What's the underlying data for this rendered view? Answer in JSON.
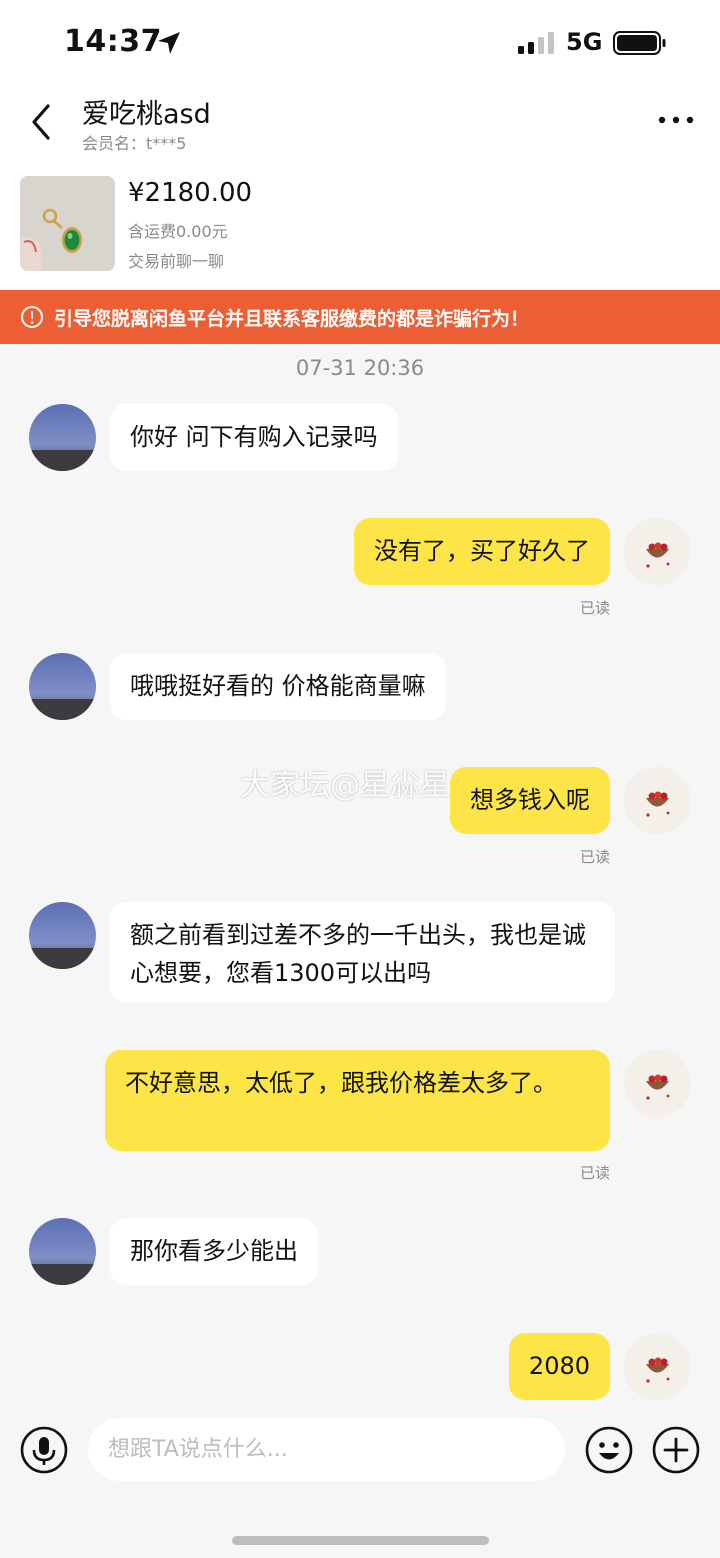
{
  "status_bar": {
    "time": "14:37",
    "network": "5G"
  },
  "header": {
    "title": "爱吃桃asd",
    "member_name": "会员名：t***5"
  },
  "product": {
    "price": "¥2180.00",
    "shipping": "含运费0.00元",
    "chat_hint": "交易前聊一聊"
  },
  "warning": {
    "text": "引导您脱离闲鱼平台并且联系客服缴费的都是诈骗行为！"
  },
  "timestamp": "07-31 20:36",
  "watermark": "大家坛@星尛星",
  "messages": [
    {
      "side": "in",
      "text": "你好 问下有购入记录吗"
    },
    {
      "side": "out",
      "text": "没有了，买了好久了",
      "status": "已读"
    },
    {
      "side": "in",
      "text": "哦哦挺好看的 价格能商量嘛"
    },
    {
      "side": "out",
      "text": "想多钱入呢",
      "status": "已读"
    },
    {
      "side": "in",
      "text": "额之前看到过差不多的一千出头，我也是诚心想要，您看1300可以出吗"
    },
    {
      "side": "out",
      "text": "不好意思，太低了，跟我价格差太多了。",
      "status": "已读"
    },
    {
      "side": "in",
      "text": "那你看多少能出"
    },
    {
      "side": "out",
      "text": "2080"
    }
  ],
  "input": {
    "placeholder": "想跟TA说点什么..."
  },
  "colors": {
    "accent_yellow": "#fde547",
    "warning_orange": "#ec5e33",
    "background": "#f6f6f6"
  },
  "icons": [
    "location-arrow-icon",
    "signal-bars-icon",
    "battery-icon",
    "back-arrow-icon",
    "more-dots-icon",
    "warning-circle-icon",
    "microphone-icon",
    "emoji-icon",
    "plus-icon"
  ]
}
